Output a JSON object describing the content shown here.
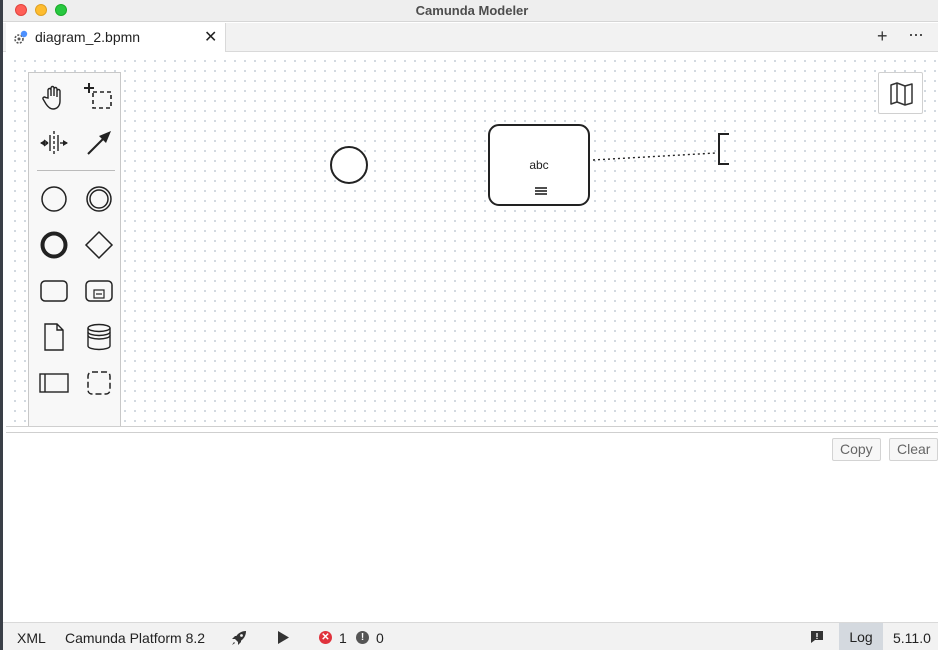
{
  "window": {
    "title": "Camunda Modeler"
  },
  "tabs": [
    {
      "label": "diagram_2.bpmn",
      "close_glyph": "✕",
      "icon": "bpmn-file-icon",
      "unsaved_dot_color": "#4d90fe"
    }
  ],
  "tabbar": {
    "add_glyph": "+",
    "more_glyph": "···"
  },
  "palette": {
    "tools": [
      "hand-tool-icon",
      "lasso-tool-icon",
      "space-tool-icon",
      "connect-tool-icon",
      "start-event-icon",
      "intermediate-event-icon",
      "end-event-icon",
      "gateway-icon",
      "task-icon",
      "subprocess-icon",
      "data-object-icon",
      "data-store-icon",
      "pool-icon",
      "group-icon"
    ]
  },
  "diagram": {
    "task_label": "abc"
  },
  "minimap": {
    "icon": "map-icon"
  },
  "log_panel": {
    "copy_label": "Copy",
    "clear_label": "Clear"
  },
  "statusbar": {
    "xml_label": "XML",
    "platform_label": "Camunda Platform 8.2",
    "error_glyph": "✕",
    "error_count": "1",
    "warning_glyph": "!",
    "warning_count": "0",
    "log_label": "Log",
    "version": "5.11.0"
  },
  "colors": {
    "error": "#e0323c",
    "log_active_bg": "#d4d9df",
    "canvas_grid": "#cfd6de"
  }
}
